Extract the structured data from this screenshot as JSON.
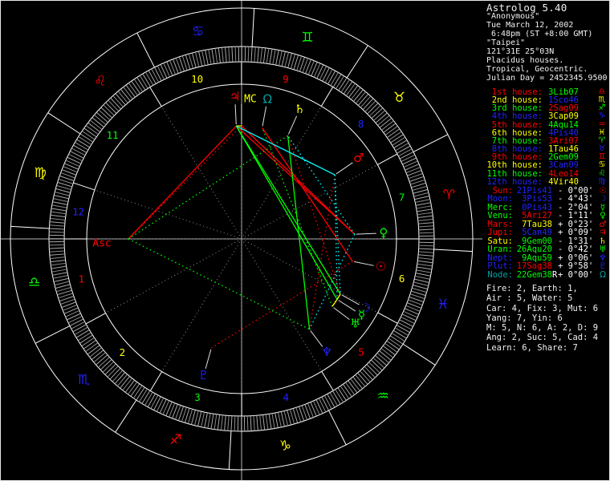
{
  "header": {
    "title": "Astrolog 5.40",
    "subject": "\"Anonymous\"",
    "date": "Tue March 12, 2002",
    "time": " 6:48pm (ST +8:00 GMT)",
    "place": "\"Taipei\"",
    "coordinates": "121°31E 25°03N",
    "house_system": "Placidus houses.",
    "zodiac_mode": "Tropical, Geocentric.",
    "julian_day": "Julian Day = 2452345.9500"
  },
  "palette": {
    "red": "#ff0000",
    "yellow": "#ffff00",
    "green": "#00ff00",
    "blue": "#2222ff",
    "teal": "#00a0a0",
    "white": "#ffffff",
    "gray": "#909090",
    "crosshair": "#b8b8b8",
    "tick": "#a8a8a8",
    "pointer": "#e0e0e0",
    "aspect_conjunction": "#ffff00",
    "aspect_sextile": "#00ffff",
    "aspect_square": "#ff0000",
    "aspect_trine": "#00ff00",
    "aspect_opposition": "#2222ff"
  },
  "houses": [
    {
      "label": "1st house:",
      "value": "3Lib07",
      "glyph": "♎",
      "label_color": "red",
      "value_color": "green",
      "glyph_color": "red",
      "cusp_deg": 183.117
    },
    {
      "label": "2nd house:",
      "value": "1Sco46",
      "glyph": "♏",
      "label_color": "yellow",
      "value_color": "blue",
      "glyph_color": "yellow",
      "cusp_deg": 211.767
    },
    {
      "label": "3rd house:",
      "value": "2Sag09",
      "glyph": "♐",
      "label_color": "green",
      "value_color": "red",
      "glyph_color": "green",
      "cusp_deg": 242.15
    },
    {
      "label": "4th house:",
      "value": "3Cap09",
      "glyph": "♑",
      "label_color": "blue",
      "value_color": "yellow",
      "glyph_color": "blue",
      "cusp_deg": 273.15
    },
    {
      "label": "5th house:",
      "value": "4Aqu14",
      "glyph": "♒",
      "label_color": "red",
      "value_color": "green",
      "glyph_color": "red",
      "cusp_deg": 304.233
    },
    {
      "label": "6th house:",
      "value": "4Pis40",
      "glyph": "♓",
      "label_color": "yellow",
      "value_color": "blue",
      "glyph_color": "yellow",
      "cusp_deg": 334.667
    },
    {
      "label": "7th house:",
      "value": "3Ari07",
      "glyph": "♈",
      "label_color": "green",
      "value_color": "red",
      "glyph_color": "green",
      "cusp_deg": 3.117
    },
    {
      "label": "8th house:",
      "value": "1Tau46",
      "glyph": "♉",
      "label_color": "blue",
      "value_color": "yellow",
      "glyph_color": "blue",
      "cusp_deg": 31.767
    },
    {
      "label": "9th house:",
      "value": "2Gem09",
      "glyph": "♊",
      "label_color": "red",
      "value_color": "green",
      "glyph_color": "red",
      "cusp_deg": 62.15
    },
    {
      "label": "10th house:",
      "value": "3Can09",
      "glyph": "♋",
      "label_color": "yellow",
      "value_color": "blue",
      "glyph_color": "yellow",
      "cusp_deg": 93.15
    },
    {
      "label": "11th house:",
      "value": "4Leo14",
      "glyph": "♌",
      "label_color": "green",
      "value_color": "red",
      "glyph_color": "green",
      "cusp_deg": 124.233
    },
    {
      "label": "12th house:",
      "value": "4Vir40",
      "glyph": "♍",
      "label_color": "blue",
      "value_color": "yellow",
      "glyph_color": "blue",
      "cusp_deg": 164.667
    }
  ],
  "planets": [
    {
      "name": "Sun",
      "label": "Sun:",
      "value": "21Pis41",
      "suffix": "",
      "velocity": "- 0°00'",
      "glyph": "☉",
      "label_color": "red",
      "value_color": "blue",
      "glyph_color": "red",
      "lon_deg": 351.683
    },
    {
      "name": "Moon",
      "label": "Moon:",
      "value": "3Pis53",
      "suffix": "",
      "velocity": "- 4°43'",
      "glyph": "☽",
      "label_color": "blue",
      "value_color": "blue",
      "glyph_color": "blue",
      "lon_deg": 333.883
    },
    {
      "name": "Mercury",
      "label": "Merc:",
      "value": "0Pis43",
      "suffix": "",
      "velocity": "- 2°04'",
      "glyph": "☿",
      "label_color": "green",
      "value_color": "blue",
      "glyph_color": "green",
      "lon_deg": 330.717
    },
    {
      "name": "Venus",
      "label": "Venu:",
      "value": "5Ari27",
      "suffix": "",
      "velocity": "- 1°11'",
      "glyph": "♀",
      "label_color": "green",
      "value_color": "red",
      "glyph_color": "green",
      "lon_deg": 5.45
    },
    {
      "name": "Mars",
      "label": "Mars:",
      "value": "7Tau38",
      "suffix": "",
      "velocity": "+ 0°23'",
      "glyph": "♂",
      "label_color": "red",
      "value_color": "yellow",
      "glyph_color": "red",
      "lon_deg": 37.633
    },
    {
      "name": "Jupiter",
      "label": "Jupi:",
      "value": "5Can49",
      "suffix": "",
      "velocity": "+ 0°09'",
      "glyph": "♃",
      "label_color": "red",
      "value_color": "blue",
      "glyph_color": "red",
      "lon_deg": 95.817
    },
    {
      "name": "Saturn",
      "label": "Satu:",
      "value": "9Gem00",
      "suffix": "",
      "velocity": "- 1°31'",
      "glyph": "♄",
      "label_color": "yellow",
      "value_color": "green",
      "glyph_color": "yellow",
      "lon_deg": 69.0
    },
    {
      "name": "Uranus",
      "label": "Uran:",
      "value": "26Aqu20",
      "suffix": "",
      "velocity": "- 0°42'",
      "glyph": "♅",
      "label_color": "green",
      "value_color": "green",
      "glyph_color": "green",
      "lon_deg": 326.333
    },
    {
      "name": "Neptune",
      "label": "Nept:",
      "value": "9Aqu59",
      "suffix": "",
      "velocity": "+ 0°06'",
      "glyph": "♆",
      "label_color": "blue",
      "value_color": "green",
      "glyph_color": "blue",
      "lon_deg": 309.983
    },
    {
      "name": "Pluto",
      "label": "Plut:",
      "value": "17Sag38",
      "suffix": "",
      "velocity": "+ 9°58'",
      "glyph": "♇",
      "label_color": "blue",
      "value_color": "red",
      "glyph_color": "blue",
      "lon_deg": 257.633
    },
    {
      "name": "Node",
      "label": "Node:",
      "value": "22Gem38",
      "suffix": "R",
      "velocity": "+ 0°00'",
      "glyph": "Ω",
      "label_color": "teal",
      "value_color": "green",
      "glyph_color": "teal",
      "lon_deg": 82.633
    }
  ],
  "stats": [
    "Fire: 2, Earth: 1,",
    "Air : 5, Water: 5",
    "Car: 4, Fix: 3, Mut: 6",
    "Yang: 7, Yin: 6",
    "M: 5, N: 6, A: 2, D: 9",
    "Ang: 2, Suc: 5, Cad: 4",
    "Learn: 6, Share: 7"
  ],
  "wheel": {
    "asc_deg": 183.117,
    "angles": {
      "Asc": 183.117,
      "MC": 93.15
    },
    "asc_label": "Asc",
    "mc_label": "MC",
    "asc_label_color": "red",
    "mc_label_color": "yellow",
    "signs": [
      {
        "name": "Aries",
        "glyph": "♈",
        "color": "red"
      },
      {
        "name": "Taurus",
        "glyph": "♉",
        "color": "yellow"
      },
      {
        "name": "Gemini",
        "glyph": "♊",
        "color": "green"
      },
      {
        "name": "Cancer",
        "glyph": "♋",
        "color": "blue"
      },
      {
        "name": "Leo",
        "glyph": "♌",
        "color": "red"
      },
      {
        "name": "Virgo",
        "glyph": "♍",
        "color": "yellow"
      },
      {
        "name": "Libra",
        "glyph": "♎",
        "color": "green"
      },
      {
        "name": "Scorpio",
        "glyph": "♏",
        "color": "blue"
      },
      {
        "name": "Sagittarius",
        "glyph": "♐",
        "color": "red"
      },
      {
        "name": "Capricorn",
        "glyph": "♑",
        "color": "yellow"
      },
      {
        "name": "Aquarius",
        "glyph": "♒",
        "color": "green"
      },
      {
        "name": "Pisces",
        "glyph": "♓",
        "color": "blue"
      }
    ],
    "house_number_colors": [
      "red",
      "yellow",
      "green",
      "blue",
      "red",
      "yellow",
      "green",
      "blue",
      "red",
      "yellow",
      "green",
      "blue"
    ],
    "aspects": [
      {
        "a": "Jupiter",
        "b": "Asc",
        "type": "square",
        "solid": true
      },
      {
        "a": "MC",
        "b": "Asc",
        "type": "square",
        "solid": false
      },
      {
        "a": "Jupiter",
        "b": "Venus",
        "type": "square",
        "solid": true
      },
      {
        "a": "Venus",
        "b": "MC",
        "type": "square",
        "solid": true
      },
      {
        "a": "Sun",
        "b": "Node",
        "type": "square",
        "solid": true
      },
      {
        "a": "Sun",
        "b": "Pluto",
        "type": "square",
        "solid": false
      },
      {
        "a": "Moon",
        "b": "Saturn",
        "type": "square",
        "solid": false
      },
      {
        "a": "Mars",
        "b": "Neptune",
        "type": "square",
        "solid": false
      },
      {
        "a": "Jupiter",
        "b": "Moon",
        "type": "trine",
        "solid": true
      },
      {
        "a": "Jupiter",
        "b": "Mercury",
        "type": "trine",
        "solid": true
      },
      {
        "a": "Saturn",
        "b": "Neptune",
        "type": "trine",
        "solid": true
      },
      {
        "a": "Asc",
        "b": "Neptune",
        "type": "trine",
        "solid": false
      },
      {
        "a": "Saturn",
        "b": "Asc",
        "type": "trine",
        "solid": false
      },
      {
        "a": "Uranus",
        "b": "Node",
        "type": "trine",
        "solid": false
      },
      {
        "a": "Jupiter",
        "b": "Mars",
        "type": "sextile",
        "solid": true
      },
      {
        "a": "Mars",
        "b": "Moon",
        "type": "sextile",
        "solid": false
      },
      {
        "a": "Mars",
        "b": "Mercury",
        "type": "sextile",
        "solid": false
      },
      {
        "a": "Venus",
        "b": "Saturn",
        "type": "sextile",
        "solid": false
      },
      {
        "a": "Venus",
        "b": "Neptune",
        "type": "sextile",
        "solid": false
      },
      {
        "a": "Moon",
        "b": "Mercury",
        "type": "conjunction",
        "solid": true
      },
      {
        "a": "Mercury",
        "b": "Uranus",
        "type": "conjunction",
        "solid": true
      },
      {
        "a": "Jupiter",
        "b": "MC",
        "type": "conjunction",
        "solid": true
      },
      {
        "a": "Moon",
        "b": "Uranus",
        "type": "conjunction",
        "solid": false
      }
    ]
  }
}
